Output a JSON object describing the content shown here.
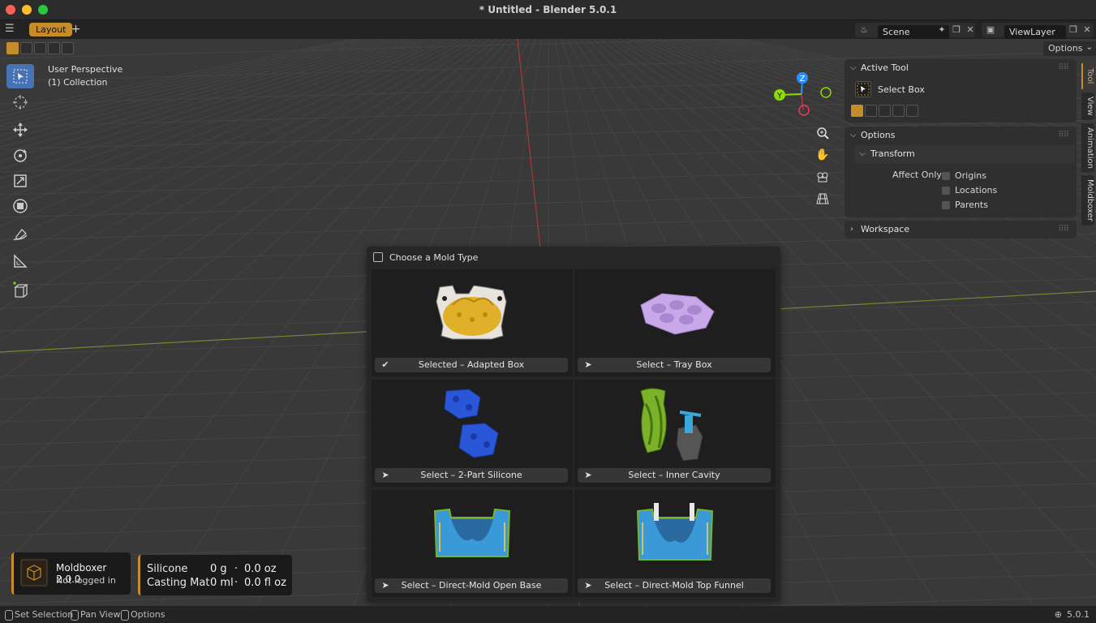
{
  "window": {
    "title": "* Untitled - Blender 5.0.1"
  },
  "topbar": {
    "workspace_tab": "Layout",
    "add_tab": "+",
    "scene_name": "Scene",
    "view_layer_name": "ViewLayer"
  },
  "viewport": {
    "options_label": "Options",
    "perspective_label": "User Perspective",
    "collection_label": "(1) Collection",
    "gizmo_axes": [
      "Z",
      "Y"
    ],
    "colors": {
      "x_axis": "#ff3352",
      "y_axis": "#8bdc00",
      "z_axis": "#2890ff",
      "accent": "#c58c2c"
    }
  },
  "toolbar": {
    "tools": [
      "select-box",
      "cursor",
      "move",
      "rotate",
      "scale",
      "transform",
      "annotate",
      "measure",
      "add-cube"
    ]
  },
  "npanel": {
    "active_tool": {
      "header": "Active Tool",
      "tool_name": "Select Box"
    },
    "options": {
      "header": "Options",
      "transform": {
        "header": "Transform",
        "affect_only_label": "Affect Only",
        "checkboxes": [
          {
            "label": "Origins",
            "checked": false
          },
          {
            "label": "Locations",
            "checked": false
          },
          {
            "label": "Parents",
            "checked": false
          }
        ]
      }
    },
    "workspace": {
      "header": "Workspace"
    },
    "tabs": [
      "Tool",
      "View",
      "Animation",
      "Moldboxer"
    ]
  },
  "popup": {
    "title": "Choose a Mold Type",
    "items": [
      {
        "label": "Selected – Adapted Box",
        "selected": true,
        "image": "yellow-hen-mold"
      },
      {
        "label": "Select – Tray Box",
        "selected": false,
        "image": "purple-tray-mold"
      },
      {
        "label": "Select – 2-Part Silicone",
        "selected": false,
        "image": "blue-two-part-mold"
      },
      {
        "label": "Select – Inner Cavity",
        "selected": false,
        "image": "green-vase-cavity"
      },
      {
        "label": "Select – Direct-Mold Open Base",
        "selected": false,
        "image": "blue-open-base-mold"
      },
      {
        "label": "Select – Direct-Mold Top Funnel",
        "selected": false,
        "image": "blue-top-funnel-mold"
      }
    ]
  },
  "moldboxer": {
    "name": "Moldboxer 2.0.0",
    "status": "Not logged in"
  },
  "materials": {
    "rows": [
      {
        "label": "Silicone",
        "value_metric": "0 g",
        "separator": "·",
        "value_imperial": "0.0 oz"
      },
      {
        "label": "Casting Mat",
        "value_metric": "0 ml",
        "separator": "·",
        "value_imperial": "0.0 fl oz"
      }
    ]
  },
  "statusbar": {
    "items": [
      "Set Selection",
      "Pan View",
      "Options"
    ],
    "version": "5.0.1"
  }
}
